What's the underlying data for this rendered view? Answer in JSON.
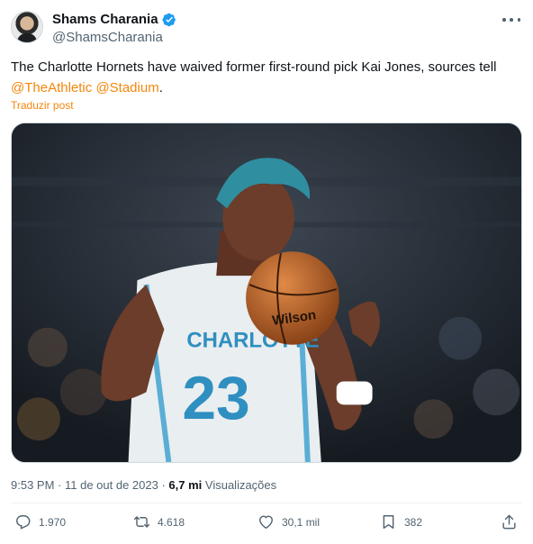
{
  "author": {
    "display_name": "Shams Charania",
    "handle": "@ShamsCharania",
    "verified_icon": "verified-badge-icon"
  },
  "tweet": {
    "text_before": "The Charlotte Hornets have waived former first-round pick Kai Jones, sources tell",
    "mention_1": "@TheAthletic",
    "mention_2": "@Stadium",
    "text_after": ".",
    "translate_label": "Traduzir post"
  },
  "media": {
    "jersey_brand": "CHARLOTTE",
    "jersey_number": "23",
    "ball_brand": "Wilson"
  },
  "meta": {
    "time": "9:53 PM",
    "separator": " · ",
    "date": "11 de out de 2023",
    "views_count": "6,7 mi",
    "views_label": "Visualizações"
  },
  "actions": {
    "replies": "1.970",
    "reposts": "4.618",
    "likes": "30,1 mil",
    "bookmarks": "382"
  },
  "colors": {
    "accent": "#f4860b",
    "verified": "#1d9bf0",
    "secondary_text": "#536471"
  }
}
